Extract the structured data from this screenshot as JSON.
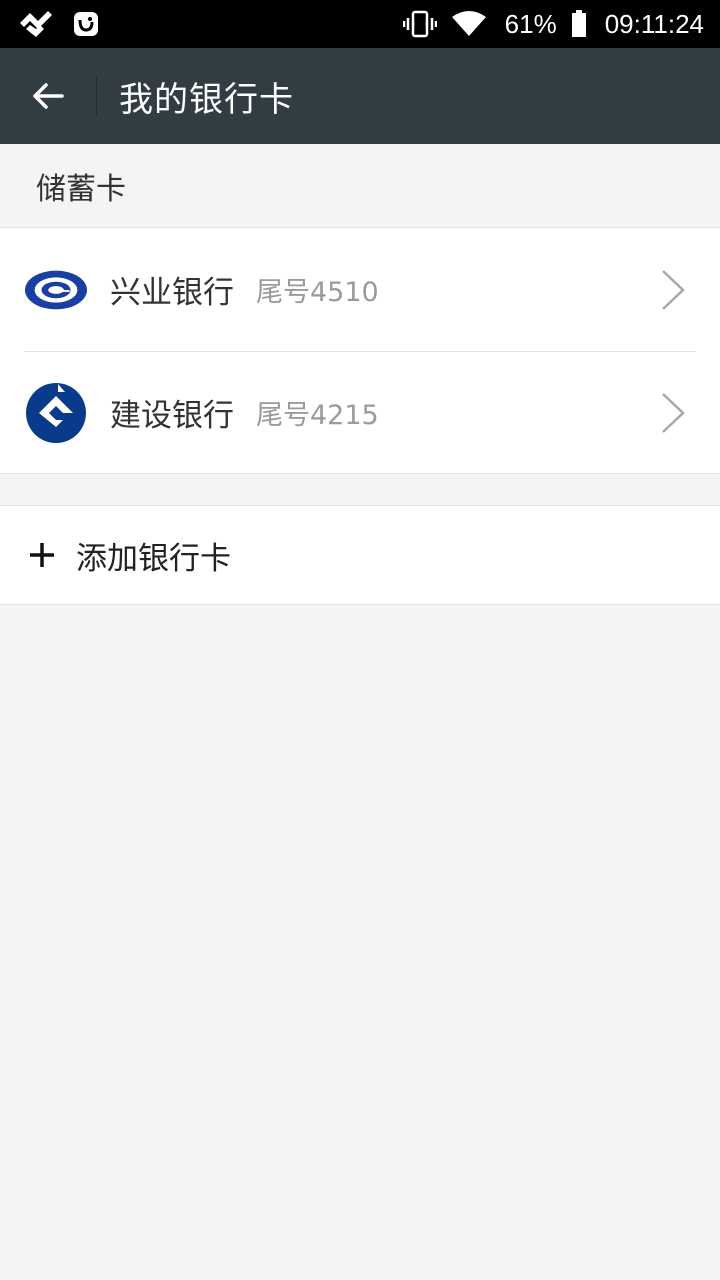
{
  "status_bar": {
    "battery": "61%",
    "time": "09:11:24",
    "icons": [
      "notification-app-icon",
      "notification-app-icon-2",
      "vibrate-icon",
      "wifi-icon",
      "battery-icon"
    ]
  },
  "header": {
    "title": "我的银行卡",
    "back_icon": "back-arrow-icon"
  },
  "section": {
    "title": "储蓄卡"
  },
  "cards": [
    {
      "bank": "兴业银行",
      "tail": "尾号4510",
      "logo": "cib-logo",
      "color": "#1a3fa3"
    },
    {
      "bank": "建设银行",
      "tail": "尾号4215",
      "logo": "ccb-logo",
      "color": "#0a3a8c"
    }
  ],
  "add_card": {
    "label": "添加银行卡",
    "icon": "plus-icon"
  }
}
